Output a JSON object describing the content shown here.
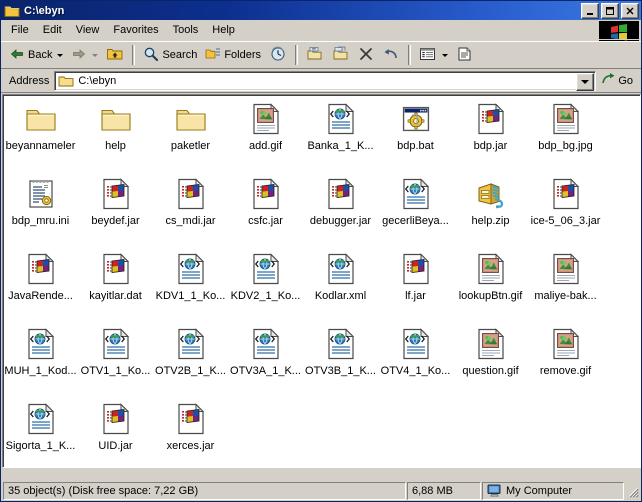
{
  "window": {
    "title": "C:\\ebyn",
    "title_icon": "folder-icon",
    "minimize_label": "Minimize",
    "maximize_label": "Maximize",
    "close_label": "Close"
  },
  "menu": {
    "items": [
      {
        "label": "File"
      },
      {
        "label": "Edit"
      },
      {
        "label": "View"
      },
      {
        "label": "Favorites"
      },
      {
        "label": "Tools"
      },
      {
        "label": "Help"
      }
    ],
    "brand_icon": "windows-flag-icon"
  },
  "toolbar": {
    "back_label": "Back",
    "back_icon": "arrow-left-icon",
    "forward_icon": "arrow-right-icon",
    "up_icon": "folder-up-icon",
    "search_label": "Search",
    "search_icon": "magnifier-icon",
    "folders_label": "Folders",
    "folders_icon": "folders-icon",
    "history_icon": "history-clock-icon",
    "moveto_icon": "move-to-folder-icon",
    "copyto_icon": "copy-to-folder-icon",
    "delete_icon": "delete-x-icon",
    "undo_icon": "undo-arrow-icon",
    "views_icon": "views-list-icon",
    "properties_icon": "properties-icon"
  },
  "address": {
    "label": "Address",
    "value": "C:\\ebyn",
    "icon": "folder-icon",
    "dropdown_icon": "chevron-down-icon",
    "go_label": "Go",
    "go_icon": "go-arrow-icon"
  },
  "files": [
    {
      "name": "beyannameler",
      "type": "folder",
      "icon": "folder-icon"
    },
    {
      "name": "help",
      "type": "folder",
      "icon": "folder-icon"
    },
    {
      "name": "paketler",
      "type": "folder",
      "icon": "folder-icon"
    },
    {
      "name": "add.gif",
      "type": "gif",
      "icon": "image-file-icon"
    },
    {
      "name": "Banka_1_K...",
      "type": "xml",
      "icon": "xml-file-icon"
    },
    {
      "name": "bdp.bat",
      "type": "bat",
      "icon": "batch-file-icon"
    },
    {
      "name": "bdp.jar",
      "type": "jar",
      "icon": "java-jar-icon"
    },
    {
      "name": "bdp_bg.jpg",
      "type": "jpg",
      "icon": "image-file-icon"
    },
    {
      "name": "bdp_mru.ini",
      "type": "ini",
      "icon": "config-file-icon"
    },
    {
      "name": "beydef.jar",
      "type": "jar",
      "icon": "java-jar-icon"
    },
    {
      "name": "cs_mdi.jar",
      "type": "jar",
      "icon": "java-jar-icon"
    },
    {
      "name": "csfc.jar",
      "type": "jar",
      "icon": "java-jar-icon"
    },
    {
      "name": "debugger.jar",
      "type": "jar",
      "icon": "java-jar-icon"
    },
    {
      "name": "gecerliBeya...",
      "type": "xml",
      "icon": "xml-file-icon"
    },
    {
      "name": "help.zip",
      "type": "zip",
      "icon": "zip-archive-icon"
    },
    {
      "name": "ice-5_06_3.jar",
      "type": "jar",
      "icon": "java-jar-icon"
    },
    {
      "name": "JavaRende...",
      "type": "jar",
      "icon": "java-jar-icon"
    },
    {
      "name": "kayitlar.dat",
      "type": "dat",
      "icon": "java-jar-icon"
    },
    {
      "name": "KDV1_1_Ko...",
      "type": "xml",
      "icon": "xml-file-icon"
    },
    {
      "name": "KDV2_1_Ko...",
      "type": "xml",
      "icon": "xml-file-icon"
    },
    {
      "name": "Kodlar.xml",
      "type": "xml",
      "icon": "xml-file-icon"
    },
    {
      "name": "lf.jar",
      "type": "jar",
      "icon": "java-jar-icon"
    },
    {
      "name": "lookupBtn.gif",
      "type": "gif",
      "icon": "image-file-icon"
    },
    {
      "name": "maliye-bak...",
      "type": "gif",
      "icon": "image-file-icon"
    },
    {
      "name": "MUH_1_Kod...",
      "type": "xml",
      "icon": "xml-file-icon"
    },
    {
      "name": "OTV1_1_Ko...",
      "type": "xml",
      "icon": "xml-file-icon"
    },
    {
      "name": "OTV2B_1_K...",
      "type": "xml",
      "icon": "xml-file-icon"
    },
    {
      "name": "OTV3A_1_K...",
      "type": "xml",
      "icon": "xml-file-icon"
    },
    {
      "name": "OTV3B_1_K...",
      "type": "xml",
      "icon": "xml-file-icon"
    },
    {
      "name": "OTV4_1_Ko...",
      "type": "xml",
      "icon": "xml-file-icon"
    },
    {
      "name": "question.gif",
      "type": "gif",
      "icon": "image-file-icon"
    },
    {
      "name": "remove.gif",
      "type": "gif",
      "icon": "image-file-icon"
    },
    {
      "name": "Sigorta_1_K...",
      "type": "xml",
      "icon": "xml-file-icon"
    },
    {
      "name": "UID.jar",
      "type": "jar",
      "icon": "java-jar-icon"
    },
    {
      "name": "xerces.jar",
      "type": "jar",
      "icon": "java-jar-icon"
    }
  ],
  "statusbar": {
    "objects_text": "35 object(s) (Disk free space: 7,22 GB)",
    "size_text": "6,88 MB",
    "zone_text": "My Computer",
    "zone_icon": "my-computer-icon"
  },
  "colors": {
    "title_gradient_start": "#0a246a",
    "title_gradient_end": "#3b7be0",
    "chrome": "#d4d0c8",
    "folder_yellow": "#ffd96b",
    "selection_blue": "#316ac5"
  }
}
